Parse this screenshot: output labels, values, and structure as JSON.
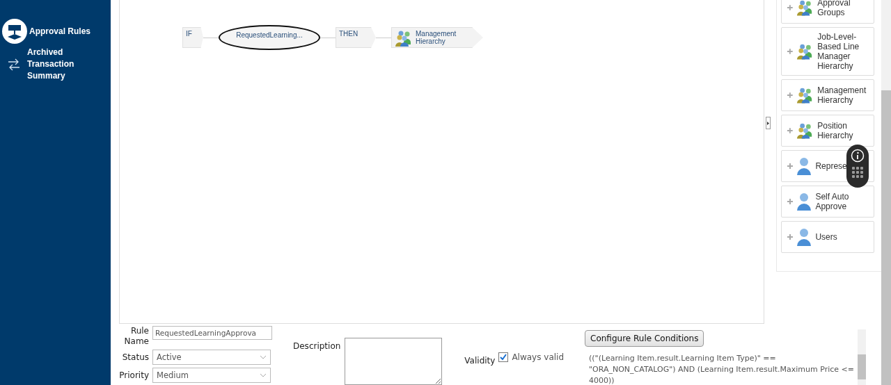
{
  "sidebar": {
    "items": [
      {
        "label": "Approval Rules",
        "kind": "rules",
        "selected": true
      },
      {
        "label": "Archived Transaction Summary",
        "kind": "transfer",
        "selected": false
      }
    ]
  },
  "rule_flow": [
    {
      "kind": "keyword",
      "label": "IF"
    },
    {
      "kind": "condition",
      "label": "RequestedLearning..."
    },
    {
      "kind": "keyword",
      "label": "THEN"
    },
    {
      "kind": "action",
      "label": "Management Hierarchy"
    }
  ],
  "palette": [
    {
      "kind": "group",
      "label": "Approval Groups"
    },
    {
      "kind": "group",
      "label": "Job-Level-Based Line Manager Hierarchy"
    },
    {
      "kind": "group",
      "label": "Management Hierarchy"
    },
    {
      "kind": "group",
      "label": "Position Hierarchy"
    },
    {
      "kind": "person",
      "label": "Represe"
    },
    {
      "kind": "person",
      "label": "Self Auto Approve"
    },
    {
      "kind": "person",
      "label": "Users"
    }
  ],
  "form": {
    "rule_name_label": "Rule Name",
    "rule_name": "RequestedLearningApprova",
    "status_label": "Status",
    "status": "Active",
    "priority_label": "Priority",
    "priority": "Medium",
    "description_label": "Description",
    "validity_label": "Validity",
    "always_valid_label": "Always valid",
    "always_valid": true,
    "configure_button": "Configure Rule Conditions",
    "condition_text": "((\"(Learning Item.result.Learning Item Type)\" == \"ORA_NON_CATALOG\") AND (Learning Item.result.Maximum Price <= 4000))"
  }
}
